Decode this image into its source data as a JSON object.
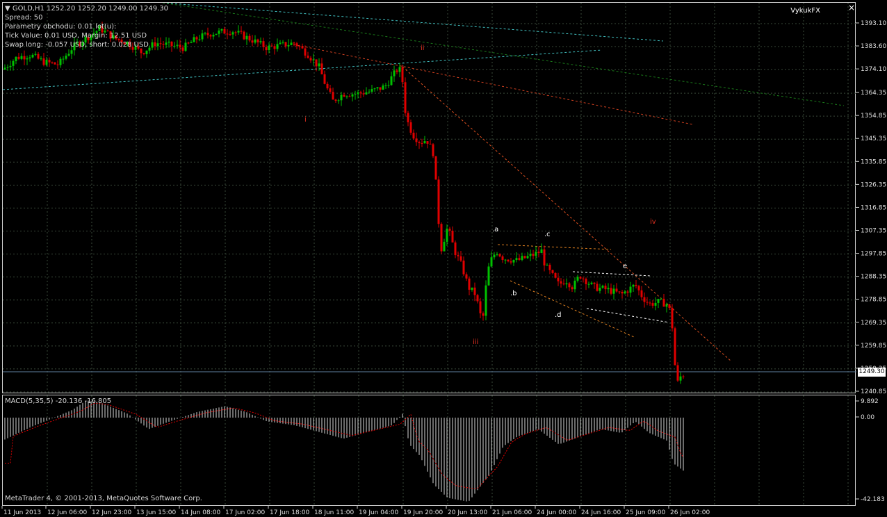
{
  "window": {
    "title": "GOLD,H1",
    "ohlc": "1252.20 1252.20 1249.00 1249.30",
    "broker": "VykukFX",
    "close_glyph": "×"
  },
  "info": {
    "spread": "Spread: 50",
    "lot_params": "Parametry obchodu: 0.01 lot(u):",
    "tick_value": "Tick Value: 0.01 USD, Margin: 12.51 USD",
    "swap": "Swap long: -0.057 USD, short: 0.028 USD"
  },
  "indicator": {
    "macd_label": "MACD(5,35,5) -20.136 -16.805"
  },
  "copyright": "MetaTrader 4, © 2001-2013, MetaQuotes Software Corp.",
  "price_axis": [
    "1393.10",
    "1383.60",
    "1374.10",
    "1364.35",
    "1354.85",
    "1345.35",
    "1335.85",
    "1326.35",
    "1316.85",
    "1307.35",
    "1297.85",
    "1288.35",
    "1278.85",
    "1269.35",
    "1259.85",
    "1250.35",
    "1240.85"
  ],
  "current_price": "1249.30",
  "macd_axis": [
    "9.892",
    "0.00",
    "-42.183"
  ],
  "time_axis": [
    "11 Jun 2013",
    "12 Jun 06:00",
    "12 Jun 23:00",
    "13 Jun 15:00",
    "14 Jun 08:00",
    "17 Jun 02:00",
    "17 Jun 18:00",
    "18 Jun 11:00",
    "19 Jun 04:00",
    "19 Jun 20:00",
    "20 Jun 13:00",
    "21 Jun 06:00",
    "24 Jun 00:00",
    "24 Jun 16:00",
    "25 Jun 09:00",
    "26 Jun 02:00"
  ],
  "waves": {
    "i": "i",
    "ii": "ii",
    "iii": "iii",
    "iv": "iv",
    "a": ".a",
    "b": ".b",
    "c": ".c",
    "d": ".d",
    "e": "e"
  },
  "colors": {
    "bull": "#00c000",
    "bear": "#e00000",
    "grid": "#3a4a3a",
    "macd_hist": "#d8d8d8",
    "macd_signal": "#e00000"
  },
  "chart_data": {
    "type": "candlestick",
    "title": "GOLD,H1",
    "ylim": [
      1240.85,
      1393.1
    ],
    "close_path": [
      [
        0,
        1375
      ],
      [
        20,
        1380
      ],
      [
        40,
        1381
      ],
      [
        60,
        1378
      ],
      [
        80,
        1377
      ],
      [
        100,
        1384
      ],
      [
        110,
        1386
      ],
      [
        140,
        1392
      ],
      [
        160,
        1388
      ],
      [
        180,
        1386
      ],
      [
        200,
        1382
      ],
      [
        220,
        1386
      ],
      [
        240,
        1385
      ],
      [
        260,
        1384
      ],
      [
        280,
        1388
      ],
      [
        300,
        1390
      ],
      [
        330,
        1391
      ],
      [
        360,
        1387
      ],
      [
        380,
        1384
      ],
      [
        400,
        1385
      ],
      [
        420,
        1386
      ],
      [
        440,
        1381
      ],
      [
        455,
        1376
      ],
      [
        465,
        1368
      ],
      [
        475,
        1362
      ],
      [
        490,
        1365
      ],
      [
        510,
        1365
      ],
      [
        530,
        1366
      ],
      [
        550,
        1368
      ],
      [
        570,
        1376
      ],
      [
        575,
        1370
      ],
      [
        580,
        1355
      ],
      [
        590,
        1348
      ],
      [
        600,
        1345
      ],
      [
        610,
        1346
      ],
      [
        620,
        1340
      ],
      [
        625,
        1320
      ],
      [
        630,
        1300
      ],
      [
        640,
        1310
      ],
      [
        650,
        1300
      ],
      [
        660,
        1294
      ],
      [
        670,
        1285
      ],
      [
        680,
        1282
      ],
      [
        690,
        1270
      ],
      [
        695,
        1285
      ],
      [
        700,
        1295
      ],
      [
        710,
        1300
      ],
      [
        720,
        1297
      ],
      [
        740,
        1296
      ],
      [
        760,
        1298
      ],
      [
        775,
        1300
      ],
      [
        780,
        1294
      ],
      [
        790,
        1290
      ],
      [
        800,
        1286
      ],
      [
        810,
        1288
      ],
      [
        820,
        1285
      ],
      [
        830,
        1290
      ],
      [
        850,
        1285
      ],
      [
        870,
        1284
      ],
      [
        890,
        1282
      ],
      [
        910,
        1286
      ],
      [
        920,
        1281
      ],
      [
        930,
        1278
      ],
      [
        945,
        1279
      ],
      [
        955,
        1278
      ],
      [
        962,
        1274
      ],
      [
        965,
        1258
      ],
      [
        970,
        1245
      ],
      [
        975,
        1248
      ],
      [
        980,
        1249
      ]
    ]
  }
}
